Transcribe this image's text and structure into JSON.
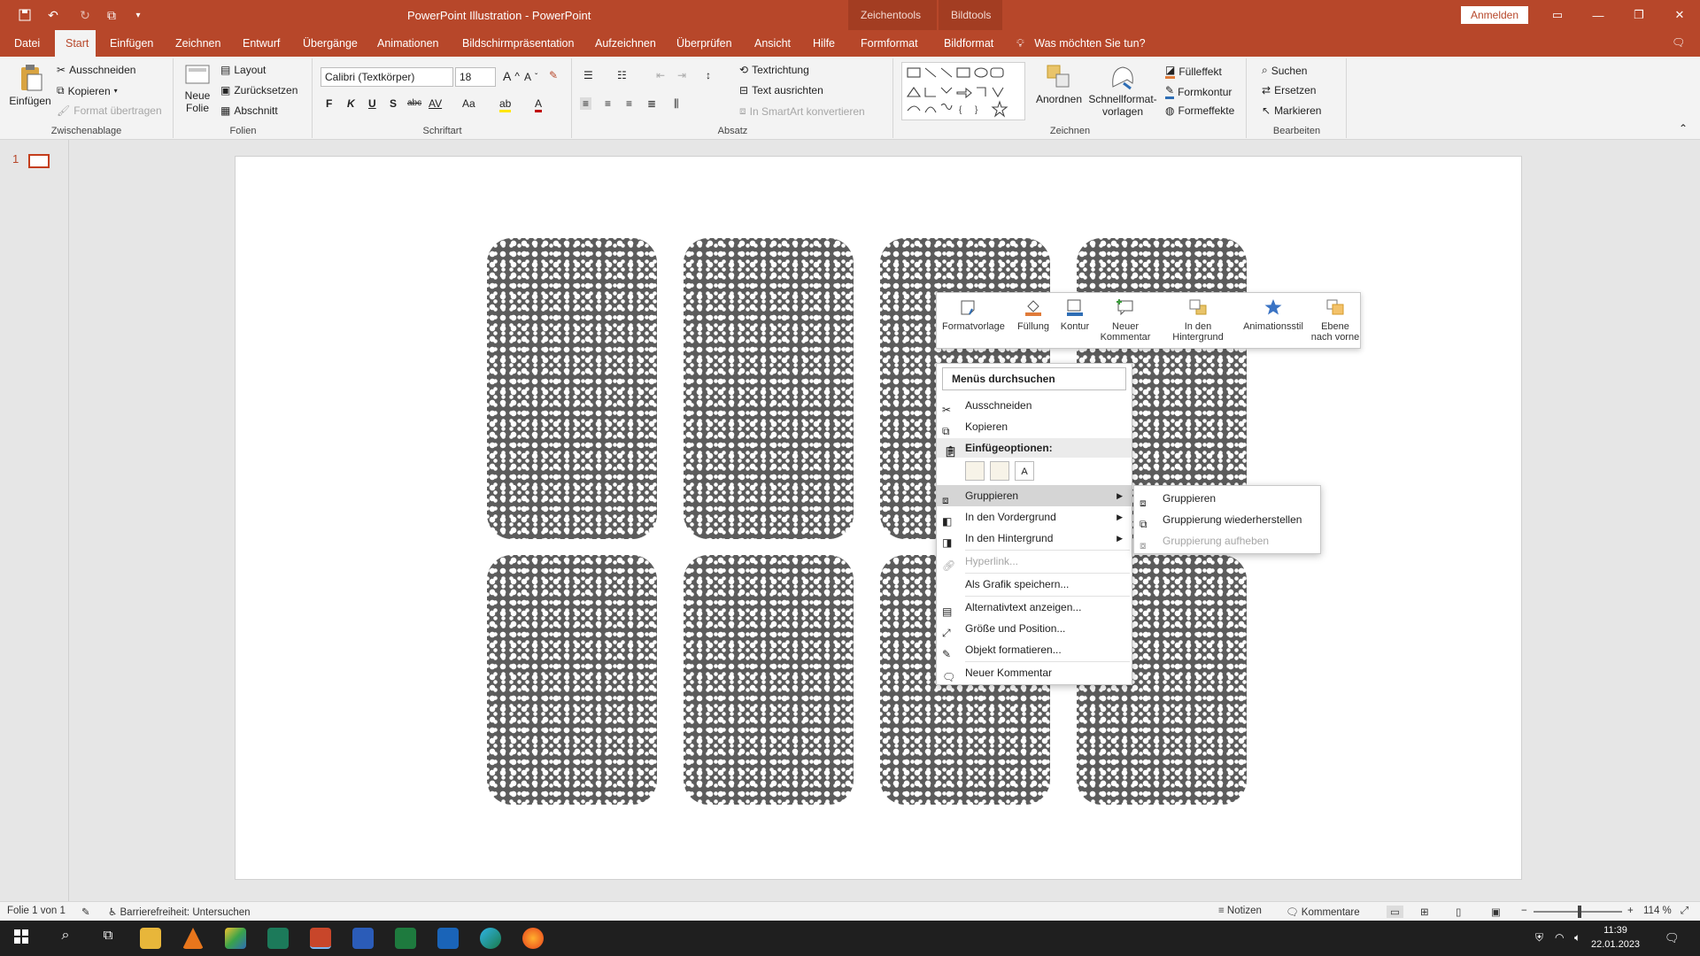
{
  "titlebar": {
    "doc_title": "PowerPoint Illustration  -  PowerPoint",
    "context_group_1": "Zeichentools",
    "context_group_2": "Bildtools",
    "signin": "Anmelden"
  },
  "tabs": [
    "Datei",
    "Start",
    "Einfügen",
    "Zeichnen",
    "Entwurf",
    "Übergänge",
    "Animationen",
    "Bildschirmpräsentation",
    "Aufzeichnen",
    "Überprüfen",
    "Ansicht",
    "Hilfe",
    "Formformat",
    "Bildformat"
  ],
  "tell_me": "Was möchten Sie tun?",
  "ribbon": {
    "clipboard": {
      "paste": "Einfügen",
      "cut": "Ausschneiden",
      "copy": "Kopieren",
      "format_painter": "Format übertragen",
      "label": "Zwischenablage"
    },
    "slides": {
      "new_slide_1": "Neue",
      "new_slide_2": "Folie",
      "layout": "Layout",
      "reset": "Zurücksetzen",
      "section": "Abschnitt",
      "label": "Folien"
    },
    "font": {
      "font_name": "Calibri (Textkörper)",
      "font_size": "18",
      "bold": "F",
      "italic": "K",
      "underline": "U",
      "shadow": "S",
      "strike": "abc",
      "spacing": "AV",
      "case": "Aa",
      "label": "Schriftart"
    },
    "paragraph": {
      "text_direction": "Textrichtung",
      "align_text": "Text ausrichten",
      "smartart": "In SmartArt konvertieren",
      "label": "Absatz"
    },
    "drawing": {
      "arrange": "Anordnen",
      "quick_styles_1": "Schnellformat-",
      "quick_styles_2": "vorlagen",
      "fill": "Fülleffekt",
      "outline": "Formkontur",
      "effects": "Formeffekte",
      "label": "Zeichnen"
    },
    "editing": {
      "find": "Suchen",
      "replace": "Ersetzen",
      "select": "Markieren",
      "label": "Bearbeiten"
    }
  },
  "slide_panel": {
    "number": "1"
  },
  "minibar": [
    {
      "label": "Formatvorlage",
      "icon": "style-icon"
    },
    {
      "label": "Füllung",
      "icon": "fill-bucket-icon"
    },
    {
      "label": "Kontur",
      "icon": "outline-pen-icon"
    },
    {
      "label": "Neuer Kommentar",
      "icon": "new-comment-icon"
    },
    {
      "label": "In den Hintergrund",
      "icon": "send-backward-icon"
    },
    {
      "label": "Animationsstil",
      "icon": "star-icon"
    },
    {
      "label": "Ebene nach vorne",
      "icon": "bring-forward-icon"
    }
  ],
  "context_menu": {
    "search": "Menüs durchsuchen",
    "cut": "Ausschneiden",
    "copy": "Kopieren",
    "paste_options": "Einfügeoptionen:",
    "group": "Gruppieren",
    "bring_front": "In den Vordergrund",
    "send_back": "In den Hintergrund",
    "hyperlink": "Hyperlink...",
    "save_as_picture": "Als Grafik speichern...",
    "alt_text": "Alternativtext anzeigen...",
    "size_position": "Größe und Position...",
    "format_object": "Objekt formatieren...",
    "new_comment": "Neuer Kommentar"
  },
  "submenu": {
    "group": "Gruppieren",
    "regroup": "Gruppierung wiederherstellen",
    "ungroup": "Gruppierung aufheben"
  },
  "statusbar": {
    "slide_info": "Folie 1 von 1",
    "accessibility": "Barrierefreiheit: Untersuchen",
    "notes": "Notizen",
    "comments": "Kommentare",
    "zoom": "114 %"
  },
  "taskbar": {
    "time": "11:39",
    "date": "22.01.2023"
  },
  "colors": {
    "accent": "#b7472a",
    "ribbon_bg": "#f3f3f3",
    "pattern": "#5c5c5c"
  }
}
